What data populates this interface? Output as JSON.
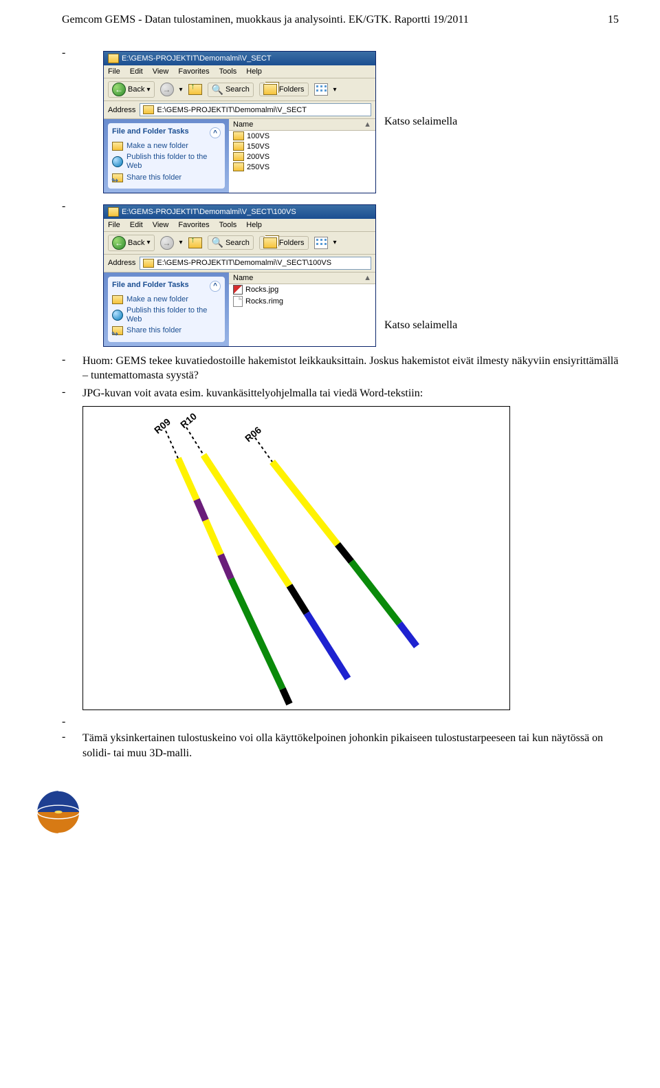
{
  "header": {
    "left": "Gemcom GEMS - Datan tulostaminen, muokkaus ja analysointi. EK/GTK. Raportti 19/2011",
    "page": "15"
  },
  "captions": {
    "katso1": "Katso selaimella",
    "katso2": "Katso selaimella"
  },
  "bullets": {
    "huom": "Huom: GEMS tekee kuvatiedostoille hakemistot leikkauksittain. Joskus hakemistot eivät ilmesty näkyviin ensiyrittämällä – tuntemattomasta syystä?",
    "jpg": "JPG-kuvan voit avata esim. kuvankäsittelyohjelmalla tai viedä Word-tekstiin:",
    "tama": "Tämä yksinkertainen tulostuskeino voi olla käyttökelpoinen johonkin pikaiseen tulostustarpeeseen tai kun näytössä on solidi- tai muu 3D-malli."
  },
  "explorer_common": {
    "menu": [
      "File",
      "Edit",
      "View",
      "Favorites",
      "Tools",
      "Help"
    ],
    "toolbar": {
      "back": "Back",
      "search": "Search",
      "folders": "Folders"
    },
    "address_label": "Address",
    "tasks_title": "File and Folder Tasks",
    "tasks": {
      "make": "Make a new folder",
      "publish": "Publish this folder to the Web",
      "share": "Share this folder"
    },
    "column": "Name",
    "sort_asc": "▲"
  },
  "explorer1": {
    "title": "E:\\GEMS-PROJEKTIT\\Demomalmi\\V_SECT",
    "address": "E:\\GEMS-PROJEKTIT\\Demomalmi\\V_SECT",
    "items": [
      {
        "type": "folder",
        "name": "100VS"
      },
      {
        "type": "folder",
        "name": "150VS"
      },
      {
        "type": "folder",
        "name": "200VS"
      },
      {
        "type": "folder",
        "name": "250VS"
      }
    ]
  },
  "explorer2": {
    "title": "E:\\GEMS-PROJEKTIT\\Demomalmi\\V_SECT\\100VS",
    "address": "E:\\GEMS-PROJEKTIT\\Demomalmi\\V_SECT\\100VS",
    "items": [
      {
        "type": "image",
        "name": "Rocks.jpg"
      },
      {
        "type": "file",
        "name": "Rocks.rimg"
      }
    ]
  },
  "diagram": {
    "labels": {
      "r09": "R09",
      "r10": "R10",
      "r06": "R06"
    }
  }
}
